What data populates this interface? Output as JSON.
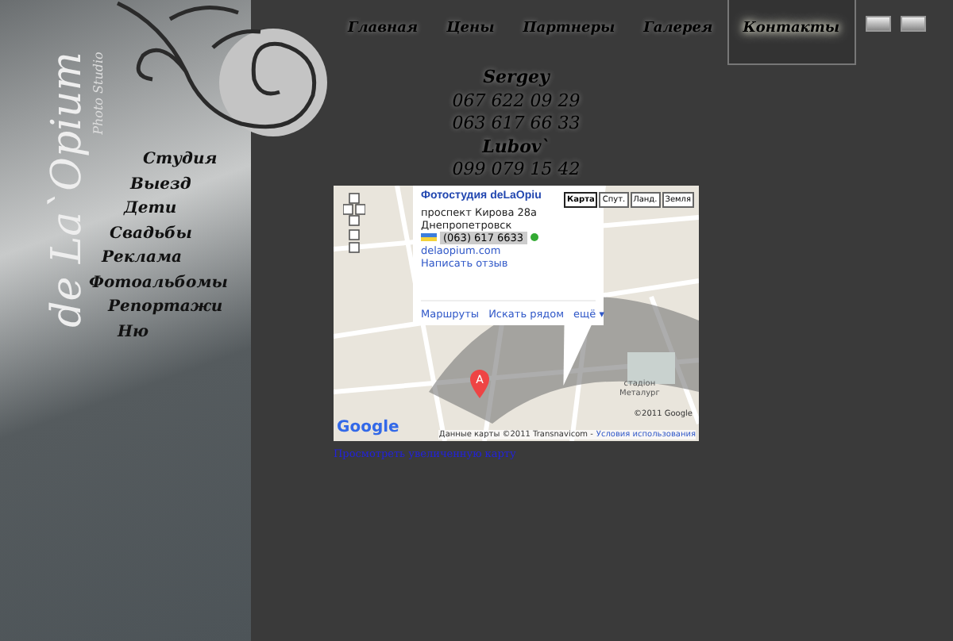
{
  "logo": {
    "title": "de La`Opium",
    "subtitle": "Photo Studio"
  },
  "side_menu": [
    {
      "label": "Студия"
    },
    {
      "label": "Выезд"
    },
    {
      "label": "Дети"
    },
    {
      "label": "Свадьбы"
    },
    {
      "label": "Реклама"
    },
    {
      "label": "Фотоальбомы"
    },
    {
      "label": "Репортажи"
    },
    {
      "label": "Ню"
    }
  ],
  "nav": [
    {
      "label": "Главная",
      "selected": false
    },
    {
      "label": "Цены",
      "selected": false
    },
    {
      "label": "Партнеры",
      "selected": false
    },
    {
      "label": "Галерея",
      "selected": false
    },
    {
      "label": "Контакты",
      "selected": true
    }
  ],
  "contacts": [
    {
      "kind": "name",
      "text": "Sergey"
    },
    {
      "kind": "phone",
      "text": "067 622 09 29"
    },
    {
      "kind": "phone",
      "text": "063 617 66 33"
    },
    {
      "kind": "name",
      "text": "Lubov`"
    },
    {
      "kind": "phone",
      "text": "099 079 15 42"
    }
  ],
  "map": {
    "map_types": [
      {
        "label": "Карта",
        "selected": true
      },
      {
        "label": "Спут.",
        "selected": false
      },
      {
        "label": "Ланд.",
        "selected": false
      },
      {
        "label": "Земля",
        "selected": false
      }
    ],
    "info": {
      "title": "Фотостудия deLaOpiu",
      "address": [
        "проспект Кирова 28а",
        "Днепропетровск"
      ],
      "phone": "(063) 617 6633",
      "links": [
        "delaopium.com",
        "Написать отзыв"
      ],
      "actions": [
        "Маршруты",
        "Искать рядом",
        "ещё ▾"
      ]
    },
    "marker": "A",
    "stadium": [
      "стадіон",
      "Металург"
    ],
    "google": "Google",
    "copyright": "©2011 Google",
    "footer": "Данные карты ©2011 Transnavicom -",
    "terms": "Условия использования"
  },
  "map_link": "Просмотреть увеличенную карту"
}
